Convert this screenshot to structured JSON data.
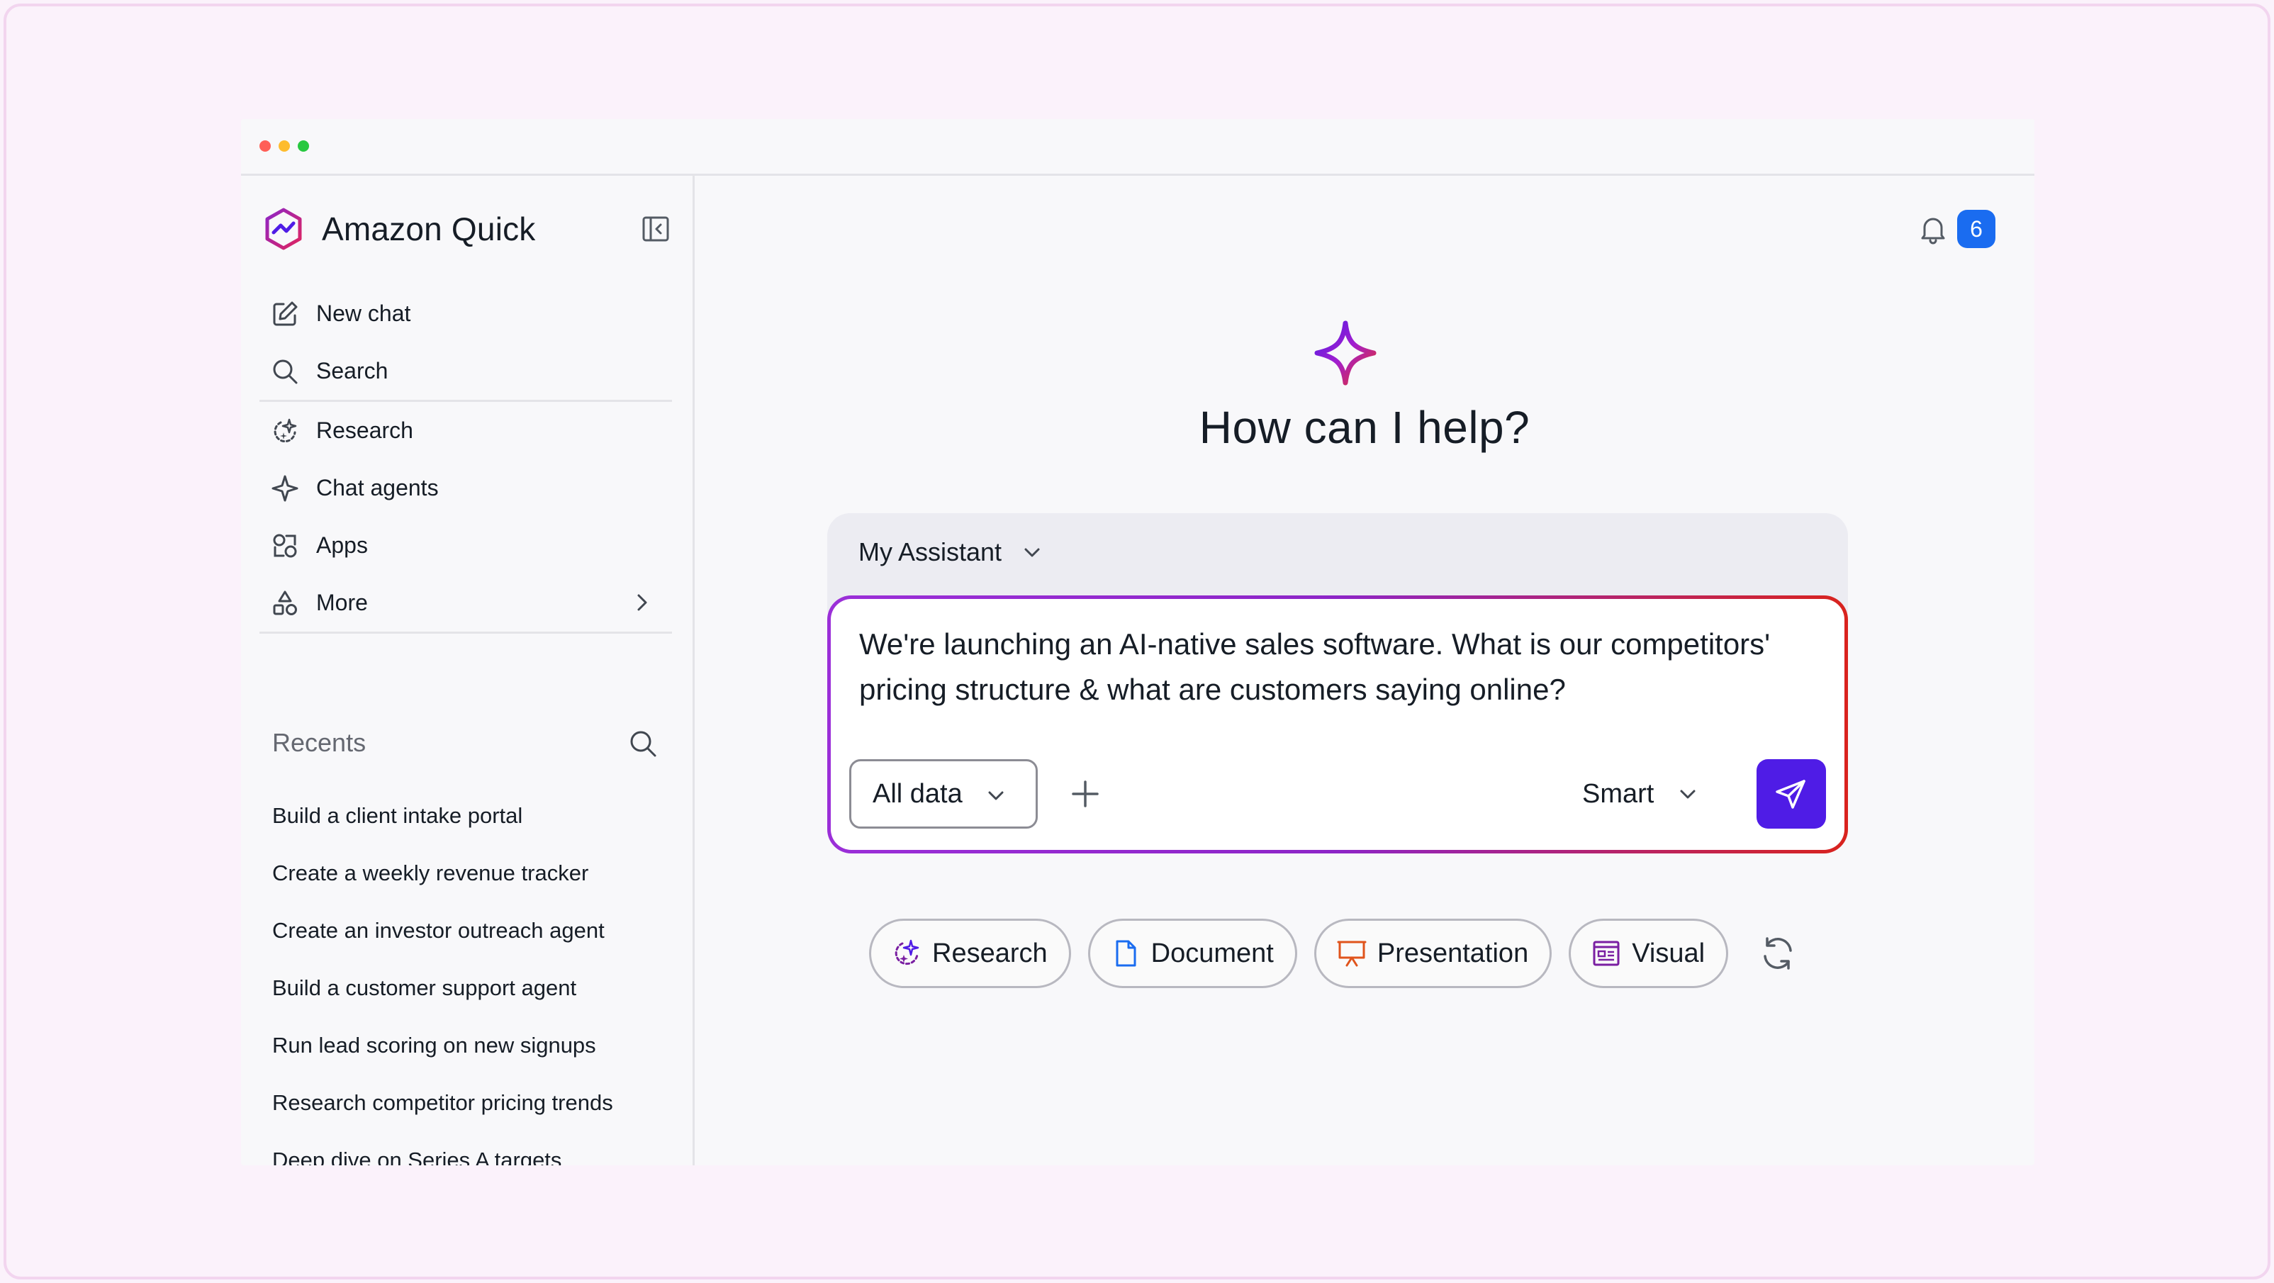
{
  "app": {
    "name": "Amazon Quick",
    "notifications_count": "6"
  },
  "sidebar": {
    "nav_primary": [
      {
        "label": "New chat",
        "icon": "edit-icon"
      },
      {
        "label": "Search",
        "icon": "search-icon"
      }
    ],
    "nav_secondary": [
      {
        "label": "Research",
        "icon": "research-sparkle-icon"
      },
      {
        "label": "Chat agents",
        "icon": "sparkle-icon"
      },
      {
        "label": "Apps",
        "icon": "apps-icon"
      },
      {
        "label": "More",
        "icon": "shapes-icon"
      }
    ],
    "recents_title": "Recents",
    "recents": [
      "Build a client intake portal",
      "Create a weekly revenue tracker",
      "Create an investor outreach agent",
      "Build a customer support agent",
      "Run lead scoring on new signups",
      "Research competitor pricing trends",
      "Deep dive on Series A targets"
    ]
  },
  "main": {
    "headline": "How can I help?",
    "assistant_label": "My Assistant",
    "prompt_text": "We're launching an AI-native sales software. What is our competitors' pricing structure & what are customers saying online?",
    "data_source": "All data",
    "mode": "Smart",
    "chips": [
      {
        "label": "Research",
        "icon": "research-icon",
        "color": "#7a1fa2"
      },
      {
        "label": "Document",
        "icon": "document-icon",
        "color": "#1a6cf0"
      },
      {
        "label": "Presentation",
        "icon": "presentation-icon",
        "color": "#e0541c"
      },
      {
        "label": "Visual",
        "icon": "visual-icon",
        "color": "#7a1fa2"
      }
    ]
  },
  "colors": {
    "accent": "#4f1ce6",
    "badge": "#1a6cf0",
    "gradient_start": "#9b2fd8",
    "gradient_end": "#d9231d"
  }
}
